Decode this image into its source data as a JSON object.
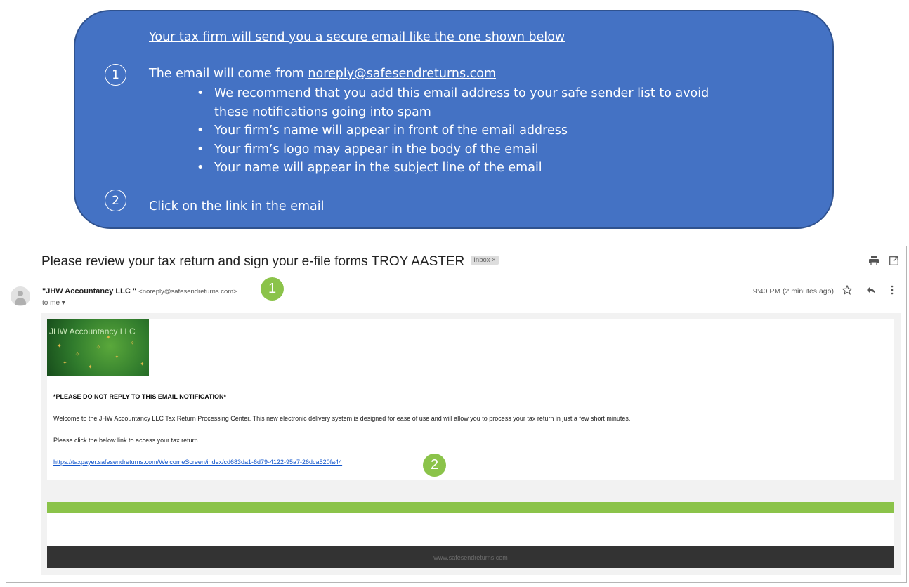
{
  "callout": {
    "heading": "Your tax firm will send you a secure email like the one shown below",
    "step1_number": "1",
    "step1_text": "The email will come from ",
    "step1_address": "noreply@safesendreturns.com",
    "bullets": [
      "We recommend that you add this email address to your safe sender list to avoid these notifications going into spam",
      "Your firm’s name will appear in front of the email address",
      "Your firm’s logo may appear in the body of the email",
      "Your name will appear in the subject line of the email"
    ],
    "step2_number": "2",
    "step2_text": "Click on the link in the email"
  },
  "email": {
    "subject": "Please review your tax return and sign your e-file forms TROY AASTER",
    "inbox_tag": "Inbox ×",
    "icons": [
      "print-icon",
      "open-in-new-window-icon",
      "star-icon",
      "reply-icon",
      "more-options-icon",
      "avatar-icon"
    ],
    "sender_name": "\"JHW Accountancy LLC \"",
    "sender_address": "<noreply@safesendreturns.com>",
    "to_label": "to me ▾",
    "timestamp": "9:40 PM (2 minutes ago)",
    "badge1": "1",
    "badge2": "2",
    "badge_color": "#8bc34a",
    "logo_text": "JHW Accountancy LLC",
    "warning": "*PLEASE DO NOT REPLY TO THIS EMAIL NOTIFICATION*",
    "welcome": "Welcome to the JHW Accountancy LLC Tax Return Processing Center. This new electronic delivery system is designed for ease of use and will allow you to process your tax return in just a few short minutes.",
    "click_text": "Please click the below link to access your tax return",
    "link": "https://taxpayer.safesendreturns.com/WelcomeScreen/index/cd683da1-6d79-4122-95a7-26dca520fa44",
    "footer": "www.safesendreturns.com"
  },
  "colors": {
    "callout_bg": "#4472c4",
    "accent_green": "#8bc34a",
    "footer_bg": "#333333",
    "link": "#1155cc"
  }
}
